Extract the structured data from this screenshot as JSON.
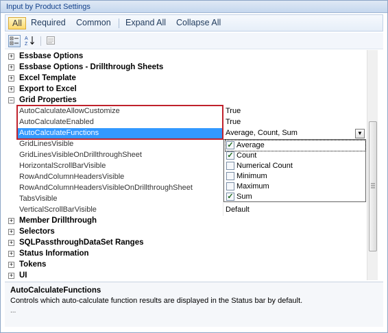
{
  "window": {
    "title": "Input by Product Settings"
  },
  "filters": {
    "all": "All",
    "required": "Required",
    "common": "Common",
    "expand_all": "Expand All",
    "collapse_all": "Collapse All"
  },
  "toolbar": {
    "categorized_icon": "categorized-icon",
    "alphabetical_icon": "alphabetical-sort-icon",
    "pages_icon": "property-pages-icon"
  },
  "grid": {
    "expander_plus": "+",
    "expander_minus": "−",
    "categories_top": [
      "Essbase Options",
      "Essbase Options - Drillthrough Sheets",
      "Excel Template",
      "Export to Excel"
    ],
    "grid_properties": "Grid Properties",
    "properties": [
      {
        "name": "AutoCalculateAllowCustomize",
        "value": "True"
      },
      {
        "name": "AutoCalculateEnabled",
        "value": "True"
      },
      {
        "name": "AutoCalculateFunctions",
        "value": "Average, Count, Sum"
      },
      {
        "name": "GridLinesVisible",
        "value": ""
      },
      {
        "name": "GridLinesVisibleOnDrillthroughSheet",
        "value": ""
      },
      {
        "name": "HorizontalScrollBarVisible",
        "value": ""
      },
      {
        "name": "RowAndColumnHeadersVisible",
        "value": ""
      },
      {
        "name": "RowAndColumnHeadersVisibleOnDrillthroughSheet",
        "value": ""
      },
      {
        "name": "TabsVisible",
        "value": ""
      },
      {
        "name": "VerticalScrollBarVisible",
        "value": "Default"
      }
    ],
    "categories_bottom": [
      "Member Drillthrough",
      "Selectors",
      "SQLPassthroughDataSet Ranges",
      "Status Information",
      "Tokens",
      "UI"
    ],
    "dropdown_arrow": "▼"
  },
  "dropdown": {
    "check_mark": "✓",
    "options": [
      {
        "label": "Average",
        "checked": true
      },
      {
        "label": "Count",
        "checked": true
      },
      {
        "label": "Numerical Count",
        "checked": false
      },
      {
        "label": "Minimum",
        "checked": false
      },
      {
        "label": "Maximum",
        "checked": false
      },
      {
        "label": "Sum",
        "checked": true
      }
    ]
  },
  "help": {
    "title": "AutoCalculateFunctions",
    "description": "Controls which auto-calculate function results are displayed in the Status bar by default.",
    "ellipsis": "..."
  },
  "colors": {
    "selection": "#3399ff",
    "highlight_border": "#c0212b",
    "title_text": "#15428b"
  }
}
